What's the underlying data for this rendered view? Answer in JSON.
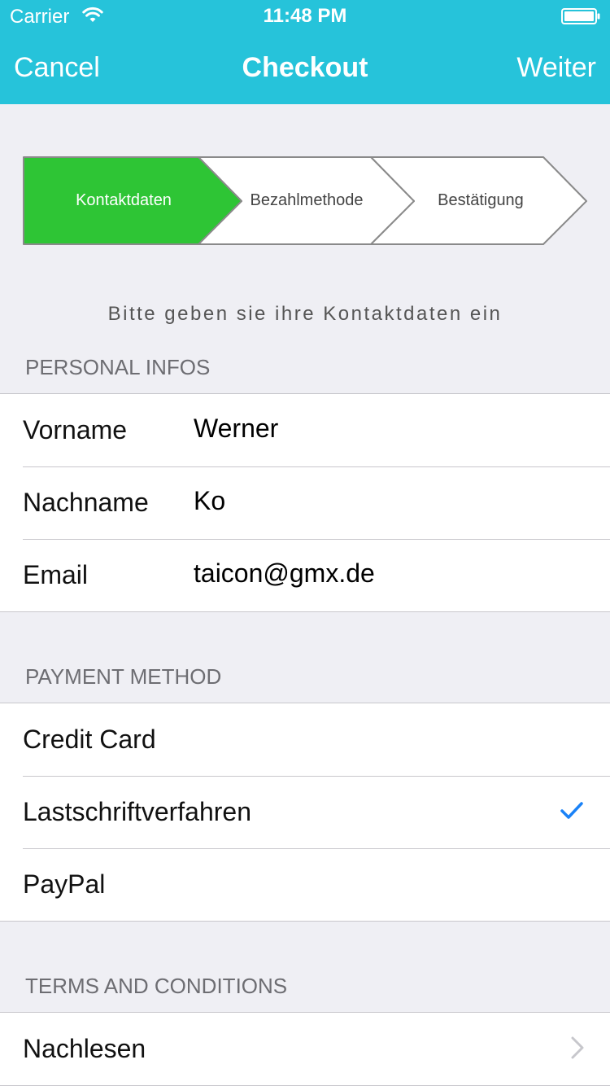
{
  "status_bar": {
    "carrier": "Carrier",
    "time": "11:48 PM"
  },
  "nav": {
    "cancel": "Cancel",
    "title": "Checkout",
    "next": "Weiter"
  },
  "stepper": {
    "steps": [
      {
        "label": "Kontaktdaten",
        "active": true
      },
      {
        "label": "Bezahlmethode",
        "active": false
      },
      {
        "label": "Bestätigung",
        "active": false
      }
    ],
    "active_color": "#2ec535"
  },
  "instruction": "Bitte geben sie ihre Kontaktdaten ein",
  "personal": {
    "header": "PERSONAL INFOS",
    "fields": [
      {
        "label": "Vorname",
        "value": "Werner"
      },
      {
        "label": "Nachname",
        "value": "Ko"
      },
      {
        "label": "Email",
        "value": "taicon@gmx.de"
      }
    ]
  },
  "payment": {
    "header": "PAYMENT METHOD",
    "options": [
      {
        "label": "Credit Card",
        "selected": false
      },
      {
        "label": "Lastschriftverfahren",
        "selected": true
      },
      {
        "label": "PayPal",
        "selected": false
      }
    ]
  },
  "terms": {
    "header": "TERMS AND CONDITIONS",
    "read_label": "Nachlesen"
  },
  "colors": {
    "accent": "#26c3da",
    "check": "#1a82f7",
    "background": "#efeff4"
  },
  "icons": {
    "wifi": "wifi-icon",
    "battery": "battery-icon",
    "check": "checkmark-icon",
    "chevron": "chevron-right-icon"
  }
}
